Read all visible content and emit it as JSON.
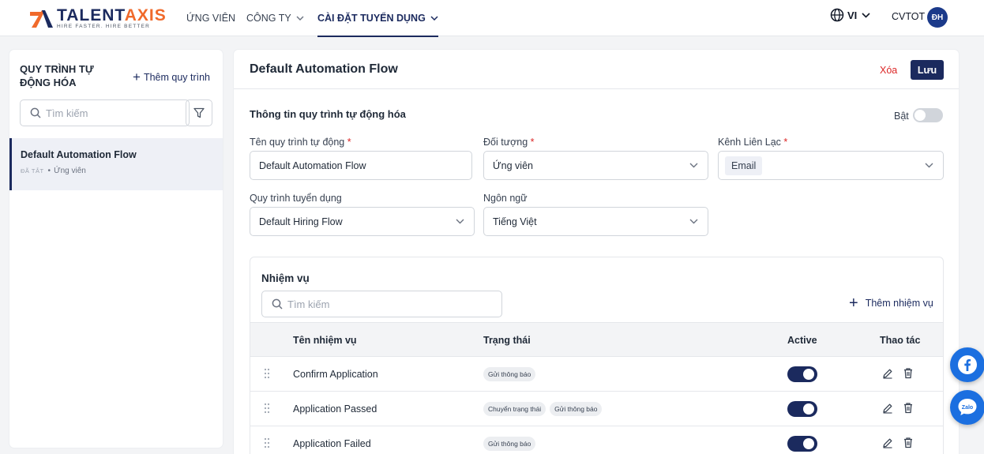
{
  "brand": {
    "name_part1": "TALENT",
    "name_part2": "AXIS",
    "tagline": "HIRE FASTER. HIRE BETTER",
    "primary_color": "#1b2a5e",
    "accent_color": "#f06a2b"
  },
  "nav": {
    "items": [
      {
        "label": "ỨNG VIÊN",
        "active": false
      },
      {
        "label": "CÔNG TY",
        "active": false,
        "has_dropdown": true
      },
      {
        "label": "CÀI ĐẶT TUYỂN DỤNG",
        "active": true,
        "has_dropdown": true
      }
    ],
    "language": "VI",
    "user_name": "CVTOT",
    "user_initials": "ĐH"
  },
  "sidebar": {
    "title": "QUY TRÌNH TỰ ĐỘNG HÓA",
    "add_label": "Thêm quy trình",
    "search_placeholder": "Tìm kiếm",
    "items": [
      {
        "title": "Default Automation Flow",
        "status": "ĐÃ TẮT",
        "target": "Ứng viên",
        "selected": true
      }
    ]
  },
  "main": {
    "title": "Default Automation Flow",
    "delete_label": "Xóa",
    "save_label": "Lưu",
    "section_title": "Thông tin quy trình tự động hóa",
    "enable_label": "Bật",
    "enabled": false,
    "fields": {
      "name": {
        "label": "Tên quy trình tự động",
        "required": "*",
        "value": "Default Automation Flow"
      },
      "target": {
        "label": "Đối tượng",
        "required": "*",
        "value": "Ứng viên"
      },
      "channel": {
        "label": "Kênh Liên Lạc",
        "required": "*",
        "value": "Email"
      },
      "hiring_flow": {
        "label": "Quy trình tuyển dụng",
        "value": "Default Hiring Flow"
      },
      "language": {
        "label": "Ngôn ngữ",
        "value": "Tiếng Việt"
      }
    }
  },
  "tasks": {
    "title": "Nhiệm vụ",
    "search_placeholder": "Tìm kiếm",
    "add_label": "Thêm nhiệm vụ",
    "columns": {
      "name": "Tên nhiệm vụ",
      "status": "Trạng thái",
      "active": "Active",
      "actions": "Thao tác"
    },
    "rows": [
      {
        "name": "Confirm Application",
        "tags": [
          "Gửi thông báo"
        ],
        "active": true
      },
      {
        "name": "Application Passed",
        "tags": [
          "Chuyển trạng thái",
          "Gửi thông báo"
        ],
        "active": true
      },
      {
        "name": "Application Failed",
        "tags": [
          "Gửi thông báo"
        ],
        "active": true
      }
    ]
  },
  "floating": {
    "facebook_icon": "facebook-icon",
    "zalo_icon": "zalo-icon",
    "zalo_text": "Zalo"
  }
}
